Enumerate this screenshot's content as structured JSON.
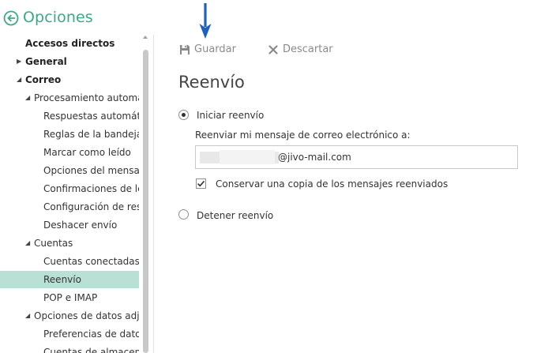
{
  "header": {
    "title": "Opciones"
  },
  "sidebar": {
    "items": [
      {
        "label": "Accesos directos",
        "level": 0,
        "caret": ""
      },
      {
        "label": "General",
        "level": 0,
        "caret": "right"
      },
      {
        "label": "Correo",
        "level": 0,
        "caret": "down"
      },
      {
        "label": "Procesamiento automático",
        "level": 1,
        "caret": "down"
      },
      {
        "label": "Respuestas automáticas",
        "level": 2,
        "caret": ""
      },
      {
        "label": "Reglas de la bandeja de entrada",
        "level": 2,
        "caret": ""
      },
      {
        "label": "Marcar como leído",
        "level": 2,
        "caret": ""
      },
      {
        "label": "Opciones del mensaje",
        "level": 2,
        "caret": ""
      },
      {
        "label": "Confirmaciones de lectura",
        "level": 2,
        "caret": ""
      },
      {
        "label": "Configuración de respuesta",
        "level": 2,
        "caret": ""
      },
      {
        "label": "Deshacer envío",
        "level": 2,
        "caret": ""
      },
      {
        "label": "Cuentas",
        "level": 1,
        "caret": "down"
      },
      {
        "label": "Cuentas conectadas",
        "level": 2,
        "caret": ""
      },
      {
        "label": "Reenvío",
        "level": 2,
        "caret": "",
        "selected": true
      },
      {
        "label": "POP e IMAP",
        "level": 2,
        "caret": ""
      },
      {
        "label": "Opciones de datos adjuntos",
        "level": 1,
        "caret": "down"
      },
      {
        "label": "Preferencias de datos adjuntos",
        "level": 2,
        "caret": ""
      },
      {
        "label": "Cuentas de almacenamiento",
        "level": 2,
        "caret": ""
      }
    ]
  },
  "toolbar": {
    "save_label": "Guardar",
    "discard_label": "Descartar"
  },
  "forwarding": {
    "title": "Reenvío",
    "start_label": "Iniciar reenvío",
    "start_selected": true,
    "email_label": "Reenviar mi mensaje de correo electrónico a:",
    "email_value": "@jivo-mail.com",
    "keep_copy_label": "Conservar una copia de los mensajes reenviados",
    "keep_copy_checked": true,
    "stop_label": "Detener reenvío",
    "stop_selected": false
  },
  "colors": {
    "accent": "#3ba88a",
    "selected_bg": "#b9e0d4",
    "annotation_arrow": "#1f5fbf"
  }
}
